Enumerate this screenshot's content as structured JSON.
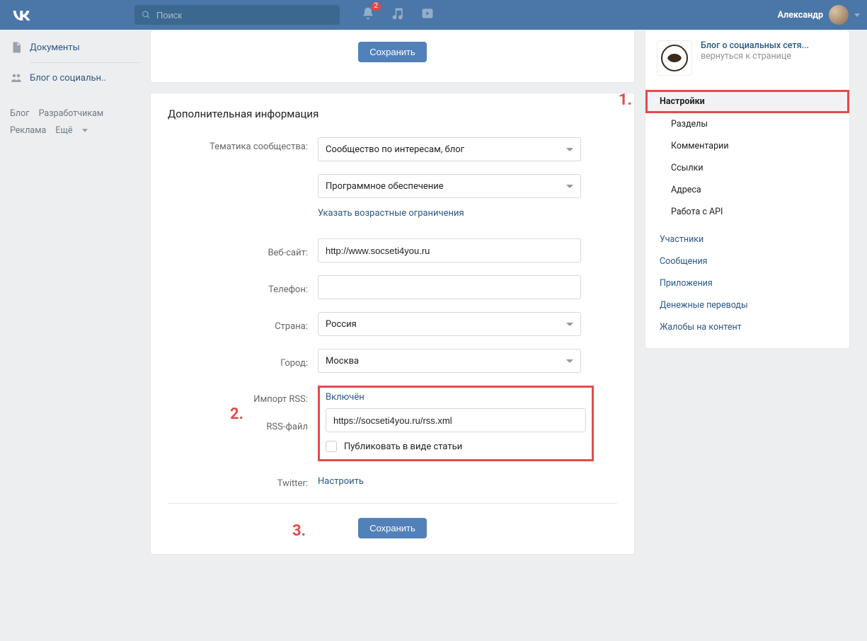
{
  "header": {
    "search_placeholder": "Поиск",
    "notif_count": "2",
    "username": "Александр"
  },
  "left_nav": {
    "documents": "Документы",
    "blog_group": "Блог о социальн..",
    "footer": {
      "blog": "Блог",
      "devs": "Разработчикам",
      "ads": "Реклама",
      "more": "Ещё"
    }
  },
  "top_card": {
    "save_label": "Сохранить"
  },
  "form": {
    "section_title": "Дополнительная информация",
    "labels": {
      "topic": "Тематика сообщества:",
      "website": "Веб-сайт:",
      "phone": "Телефон:",
      "country": "Страна:",
      "city": "Город:",
      "rss_import": "Импорт RSS:",
      "rss_file": "RSS-файл",
      "twitter": "Twitter:"
    },
    "topic_main": "Сообщество по интересам, блог",
    "topic_sub": "Программное обеспечение",
    "age_link": "Указать возрастные ограничения",
    "website_value": "http://www.socseti4you.ru",
    "phone_value": "",
    "country_value": "Россия",
    "city_value": "Москва",
    "rss_status": "Включён",
    "rss_file_value": "https://socseti4you.ru/rss.xml",
    "publish_article_label": "Публиковать в виде статьи",
    "twitter_link": "Настроить",
    "save_label": "Сохранить"
  },
  "right": {
    "group_title": "Блог о социальных сетя...",
    "group_sub": "вернуться к странице",
    "menu": {
      "settings": "Настройки",
      "sections": "Разделы",
      "comments": "Комментарии",
      "links": "Ссылки",
      "addresses": "Адреса",
      "api": "Работа с API",
      "members": "Участники",
      "messages": "Сообщения",
      "apps": "Приложения",
      "money": "Денежные переводы",
      "complaints": "Жалобы на контент"
    }
  },
  "annotations": {
    "n1": "1.",
    "n2": "2.",
    "n3": "3."
  }
}
